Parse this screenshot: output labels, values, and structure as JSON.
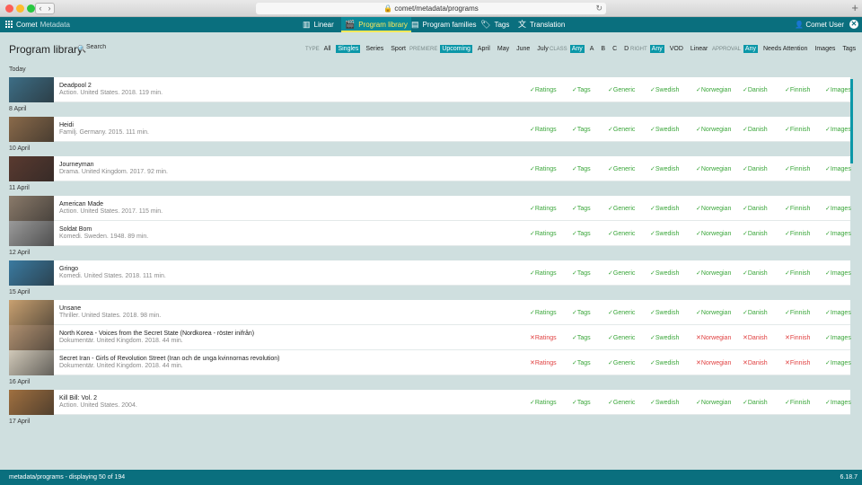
{
  "browser": {
    "url": "comet/metadata/programs",
    "new_tab": "+"
  },
  "app": {
    "brand": "Comet",
    "brand_sub": "Metadata",
    "user": "Comet User"
  },
  "nav": [
    {
      "label": "Linear",
      "icon": "▥"
    },
    {
      "label": "Program library",
      "icon": "🎬"
    },
    {
      "label": "Program families",
      "icon": "▤"
    },
    {
      "label": "Tags",
      "icon": "🏷"
    },
    {
      "label": "Translation",
      "icon": "文"
    }
  ],
  "page": {
    "title": "Program library",
    "search_placeholder": "Search"
  },
  "filters": [
    {
      "label": "TYPE",
      "options": [
        "All",
        "Singles",
        "Series",
        "Sport"
      ],
      "selected": "Singles"
    },
    {
      "label": "PREMIERE",
      "options": [
        "Upcoming",
        "April",
        "May",
        "June",
        "July"
      ],
      "selected": "Upcoming"
    },
    {
      "label": "CLASS",
      "options": [
        "Any",
        "A",
        "B",
        "C",
        "D"
      ],
      "selected": "Any"
    },
    {
      "label": "RIGHT",
      "options": [
        "Any",
        "VOD",
        "Linear"
      ],
      "selected": "Any"
    },
    {
      "label": "APPROVAL",
      "options": [
        "Any",
        "Needs Attention",
        "Images",
        "Tags"
      ],
      "selected": "Any"
    }
  ],
  "status_columns": [
    "Ratings",
    "Tags",
    "Generic",
    "Swedish",
    "Norwegian",
    "Danish",
    "Finnish",
    "Images"
  ],
  "groups": [
    {
      "date": "Today",
      "programs": [
        {
          "title": "Deadpool 2",
          "meta": "Action. United States. 2018. 119 min.",
          "thumb": "#3d6e86",
          "status": [
            "ok",
            "ok",
            "ok",
            "ok",
            "ok",
            "ok",
            "ok",
            "ok"
          ]
        }
      ]
    },
    {
      "date": "8 April",
      "programs": [
        {
          "title": "Heidi",
          "meta": "Familj. Germany. 2015. 111 min.",
          "thumb": "#8a6a4a",
          "status": [
            "ok",
            "ok",
            "ok",
            "ok",
            "ok",
            "ok",
            "ok",
            "ok"
          ]
        }
      ]
    },
    {
      "date": "10 April",
      "programs": [
        {
          "title": "Journeyman",
          "meta": "Drama. United Kingdom. 2017. 92 min.",
          "thumb": "#5a3a30",
          "status": [
            "ok",
            "ok",
            "ok",
            "ok",
            "ok",
            "ok",
            "ok",
            "ok"
          ]
        }
      ]
    },
    {
      "date": "11 April",
      "programs": [
        {
          "title": "American Made",
          "meta": "Action. United States. 2017. 115 min.",
          "thumb": "#8a7a6a",
          "status": [
            "ok",
            "ok",
            "ok",
            "ok",
            "ok",
            "ok",
            "ok",
            "ok"
          ]
        },
        {
          "title": "Soldat Bom",
          "meta": "Komedi. Sweden. 1948. 89 min.",
          "thumb": "#9a9a9a",
          "status": [
            "ok",
            "ok",
            "ok",
            "ok",
            "ok",
            "ok",
            "ok",
            "ok"
          ]
        }
      ]
    },
    {
      "date": "12 April",
      "programs": [
        {
          "title": "Gringo",
          "meta": "Komedi. United States. 2018. 111 min.",
          "thumb": "#3a7aa0",
          "status": [
            "ok",
            "ok",
            "ok",
            "ok",
            "ok",
            "ok",
            "ok",
            "ok"
          ]
        }
      ]
    },
    {
      "date": "15 April",
      "programs": [
        {
          "title": "Unsane",
          "meta": "Thriller. United States. 2018. 98 min.",
          "thumb": "#c8a070",
          "status": [
            "ok",
            "ok",
            "ok",
            "ok",
            "ok",
            "ok",
            "ok",
            "ok"
          ]
        },
        {
          "title": "North Korea - Voices from the Secret State (Nordkorea - röster inifrån)",
          "meta": "Dokumentär. United Kingdom. 2018. 44 min.",
          "thumb": "#b09070",
          "status": [
            "bad",
            "ok",
            "ok",
            "ok",
            "bad",
            "bad",
            "bad",
            "ok"
          ]
        },
        {
          "title": "Secret Iran - Girls of Revolution Street (Iran och de unga kvinnornas revolution)",
          "meta": "Dokumentär. United Kingdom. 2018. 44 min.",
          "thumb": "#d0c8b8",
          "status": [
            "bad",
            "ok",
            "ok",
            "ok",
            "bad",
            "bad",
            "bad",
            "ok"
          ]
        }
      ]
    },
    {
      "date": "16 April",
      "programs": [
        {
          "title": "Kill Bill: Vol. 2",
          "meta": "Action. United States. 2004.",
          "thumb": "#a07040",
          "status": [
            "ok",
            "ok",
            "ok",
            "ok",
            "ok",
            "ok",
            "ok",
            "ok"
          ]
        }
      ]
    },
    {
      "date": "17 April",
      "programs": []
    }
  ],
  "footer": {
    "left": "metadata/programs - displaying 50 of 194",
    "right": "6.18.7"
  }
}
